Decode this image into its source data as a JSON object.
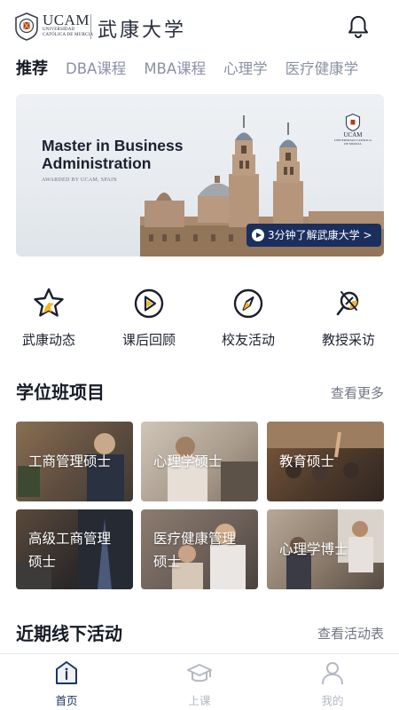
{
  "header": {
    "logo_wordmark": "UCAM",
    "logo_subline1": "UNIVERSIDAD",
    "logo_subline2": "CATÓLICA DE MURCIA",
    "school_name": "武康大学",
    "bell_icon": "bell-icon"
  },
  "tabs": [
    {
      "label": "推荐",
      "active": true
    },
    {
      "label": "DBA课程",
      "active": false
    },
    {
      "label": "MBA课程",
      "active": false
    },
    {
      "label": "心理学",
      "active": false
    },
    {
      "label": "医疗健康学",
      "active": false
    }
  ],
  "banner": {
    "title": "Master in Business Administration",
    "subtitle": "AWARDED BY UCAM, SPAIN",
    "mini_logo": "UCAM",
    "mini_logo_sub": "UNIVERSIDAD CATÓLICA DE MURCIA",
    "video_button": "3分钟了解武康大学 >"
  },
  "quick_links": [
    {
      "label": "武康动态",
      "icon": "star-icon"
    },
    {
      "label": "课后回顾",
      "icon": "play-circle-icon"
    },
    {
      "label": "校友活动",
      "icon": "compass-icon"
    },
    {
      "label": "教授采访",
      "icon": "microphone-icon"
    }
  ],
  "programs_section": {
    "title": "学位班项目",
    "more": "查看更多",
    "items": [
      {
        "line1": "工商管理硕士",
        "line2": ""
      },
      {
        "line1": "心理学硕士",
        "line2": ""
      },
      {
        "line1": "教育硕士",
        "line2": ""
      },
      {
        "line1": "高级工商管理",
        "line2": "硕士"
      },
      {
        "line1": "医疗健康管理",
        "line2": "硕士"
      },
      {
        "line1": "心理学博士",
        "line2": ""
      }
    ]
  },
  "events_section": {
    "title": "近期线下活动",
    "more": "查看活动表"
  },
  "bottom_nav": [
    {
      "label": "首页",
      "icon": "home-icon",
      "active": true
    },
    {
      "label": "上课",
      "icon": "graduation-cap-icon",
      "active": false
    },
    {
      "label": "我的",
      "icon": "user-icon",
      "active": false
    }
  ],
  "colors": {
    "brand_navy": "#1a3566",
    "accent_yellow": "#f5b52a",
    "text_dark": "#161b27",
    "text_muted": "#8a92a3"
  }
}
